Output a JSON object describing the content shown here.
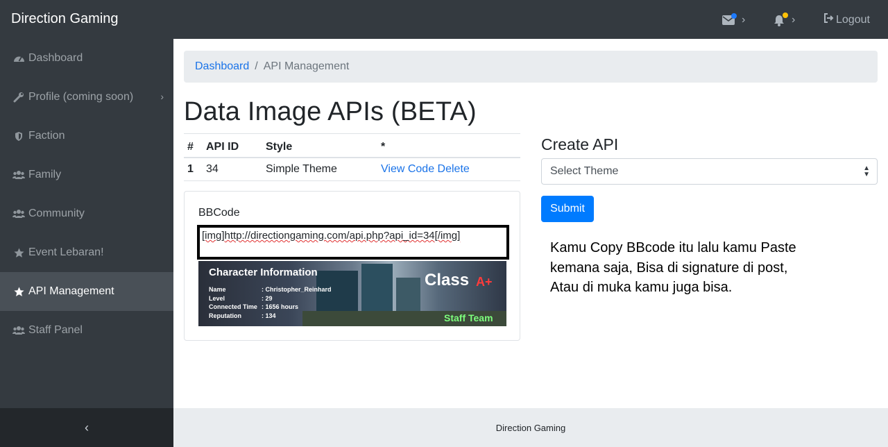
{
  "brand": "Direction Gaming",
  "topbar": {
    "logout_label": "Logout"
  },
  "sidebar": {
    "items": [
      {
        "label": "Dashboard",
        "icon": "tachometer-icon"
      },
      {
        "label": "Profile (coming soon)",
        "icon": "wrench-icon"
      },
      {
        "label": "Faction",
        "icon": "shield-icon"
      },
      {
        "label": "Family",
        "icon": "users-icon"
      },
      {
        "label": "Community",
        "icon": "users-icon"
      },
      {
        "label": "Event Lebaran!",
        "icon": "star-icon"
      },
      {
        "label": "API Management",
        "icon": "star-icon",
        "active": true
      },
      {
        "label": "Staff Panel",
        "icon": "users-icon"
      }
    ]
  },
  "breadcrumb": {
    "home": "Dashboard",
    "separator": "/",
    "current": "API Management"
  },
  "page_title": "Data Image APIs (BETA)",
  "table": {
    "headers": [
      "#",
      "API ID",
      "Style",
      "*"
    ],
    "rows": [
      {
        "index": "1",
        "api_id": "34",
        "style": "Simple Theme",
        "view": "View Code",
        "delete": "Delete"
      }
    ]
  },
  "bbcode": {
    "label": "BBCode",
    "prefix": "[img]",
    "url": "http://directiongaming.com/api.php?api_id=34",
    "suffix": "[/img]"
  },
  "signature": {
    "title": "Character Information",
    "rows": [
      {
        "key": "Name",
        "value": ": Christopher_Reinhard"
      },
      {
        "key": "Level",
        "value": ": 29"
      },
      {
        "key": "Connected Time",
        "value": ": 1656 hours"
      },
      {
        "key": "Reputation",
        "value": ": 134"
      }
    ],
    "class_label": "Class",
    "class_grade": "A+",
    "team": "Staff Team"
  },
  "create_api": {
    "title": "Create API",
    "select_value": "Select Theme",
    "submit_label": "Submit"
  },
  "note_lines": [
    "Kamu Copy BBcode itu lalu kamu Paste",
    "kemana saja, Bisa di signature di post,",
    "Atau di muka kamu juga bisa."
  ],
  "footer": "Direction Gaming",
  "colors": {
    "primary": "#007bff",
    "sidebar": "#343a40",
    "message_dot": "#1e7bff",
    "bell_dot": "#ffc107"
  }
}
